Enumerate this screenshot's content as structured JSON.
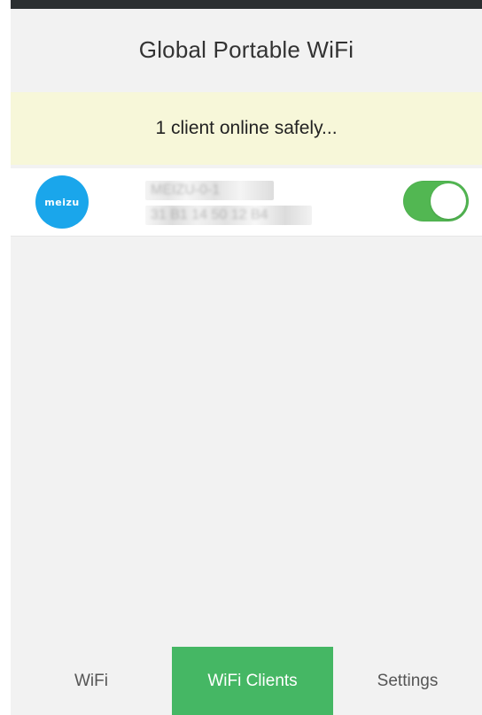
{
  "header": {
    "title": "Global Portable WiFi"
  },
  "status": {
    "message": "1 client online safely..."
  },
  "clients": [
    {
      "logo_text": "meizu",
      "name": "MEIZU-0-1",
      "mac": "31 B1 14 50 12 B4",
      "enabled": true
    }
  ],
  "tabs": [
    {
      "label": "WiFi",
      "active": false
    },
    {
      "label": "WiFi Clients",
      "active": true
    },
    {
      "label": "Settings",
      "active": false
    }
  ],
  "colors": {
    "accent": "#45b764",
    "toggle_on": "#52b752",
    "client_logo": "#1aa6eb",
    "banner": "#f7f7d9",
    "top_strip": "#2b2f31"
  }
}
